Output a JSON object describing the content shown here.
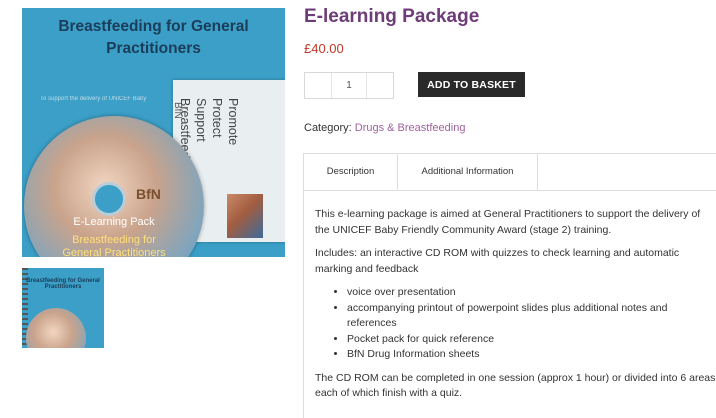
{
  "product": {
    "title": "E-learning Package",
    "price": "£40.00",
    "quantity": "1",
    "add_to_basket_label": "ADD TO BASKET",
    "category_label": "Category:",
    "category_link": "Drugs & Breastfeeding"
  },
  "image": {
    "cover_title_line1": "Breastfeeding for General",
    "cover_title_line2": "Practitioners",
    "cover_subline": "To support the delivery of UNICEF Baby",
    "insert_bfn": "BfN",
    "slogan": [
      "Promote",
      "Protect",
      "Support",
      "Breastfeeding"
    ],
    "disc_logo": "BfN",
    "disc_pack_label": "E-Learning Pack",
    "disc_title_line1": "Breastfeeding for",
    "disc_title_line2": "General Practitioners",
    "thumb_title": "Breastfeeding for General Practitioners"
  },
  "tabs": [
    {
      "label": "Description"
    },
    {
      "label": "Additional Information"
    }
  ],
  "description": {
    "p1": "This e-learning package is aimed at General Practitioners to support the delivery of the UNICEF Baby Friendly Community Award (stage 2) training.",
    "p2": "Includes: an interactive CD ROM with quizzes to check learning and automatic marking and feedback",
    "bullets": [
      "voice over presentation",
      "accompanying printout of powerpoint slides plus additional notes and references",
      "Pocket pack for quick reference",
      "BfN Drug Information sheets"
    ],
    "p3": "The CD ROM can be completed in one session (approx 1 hour) or divided into 6 areas each of which finish with a quiz."
  }
}
